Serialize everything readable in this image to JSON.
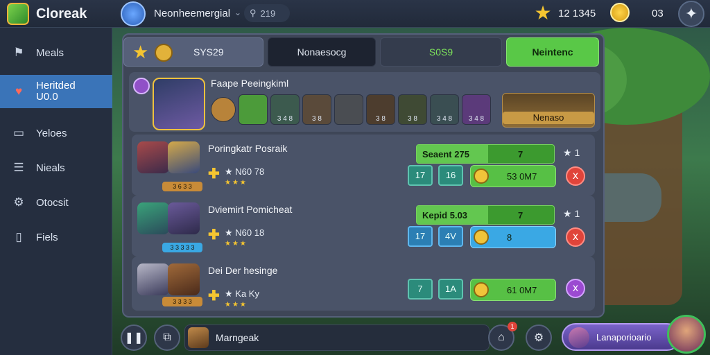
{
  "topbar": {
    "brand": "Cloreak",
    "username": "Neonheemergial",
    "search_text": "219",
    "stars": "12 1345",
    "coins": "03"
  },
  "sidebar": {
    "items": [
      {
        "label": "Meals",
        "icon": "flag-icon"
      },
      {
        "label": "Heritded\nU0.0",
        "icon": "heart-icon"
      },
      {
        "label": "Yeloes",
        "icon": "chat-icon"
      },
      {
        "label": "Nieals",
        "icon": "list-icon"
      },
      {
        "label": "Otocsit",
        "icon": "gear-icon"
      },
      {
        "label": "Fiels",
        "icon": "document-icon"
      }
    ]
  },
  "tabs": [
    {
      "label": "SYS29"
    },
    {
      "label": "Nonaesocg"
    },
    {
      "label": "S0S9"
    },
    {
      "label": "Neintenc"
    }
  ],
  "hero": {
    "name": "Faape Peeingkiml",
    "slots": [
      {
        "num": ""
      },
      {
        "num": ""
      },
      {
        "num": "3 4 8"
      },
      {
        "num": "3 8"
      },
      {
        "num": ""
      },
      {
        "num": "3 8"
      },
      {
        "num": "3 8"
      },
      {
        "num": "3 4 8"
      },
      {
        "num": "3 4 8"
      }
    ],
    "equip_label": "Nenaso"
  },
  "rows": [
    {
      "title": "Poringkatr Posraik",
      "stat": "N60 78",
      "strip": "3 6 3 3",
      "bar_label": "Seaent 275",
      "bar_fill": 0.52,
      "bar_value": "7",
      "rank": "1",
      "sq1": "17",
      "sq2": "16",
      "pill_value": "53 0M7",
      "pill_color": "green",
      "close": "x"
    },
    {
      "title": "Dviemirt Pomicheat",
      "stat": "N60 18",
      "strip": "3 3 3 3 3",
      "bar_label": "Kepid 5.03",
      "bar_fill": 0.52,
      "bar_value": "7",
      "rank": "1",
      "sq1": "17",
      "sq2": "4V",
      "pill_value": "8",
      "pill_color": "blue",
      "close": "x"
    },
    {
      "title": "Dei Der hesinge",
      "stat": "Ka Ky",
      "strip": "3 3 3 3",
      "bar_label": "",
      "bar_fill": 0.0,
      "bar_value": "",
      "rank": "",
      "sq1": "7",
      "sq2": "1A",
      "pill_value": "61 0M7",
      "pill_color": "green",
      "close": "x"
    }
  ],
  "bottom": {
    "pill_label": "Marngeak",
    "notif": "1",
    "profile_label": "Lanaporioario"
  }
}
